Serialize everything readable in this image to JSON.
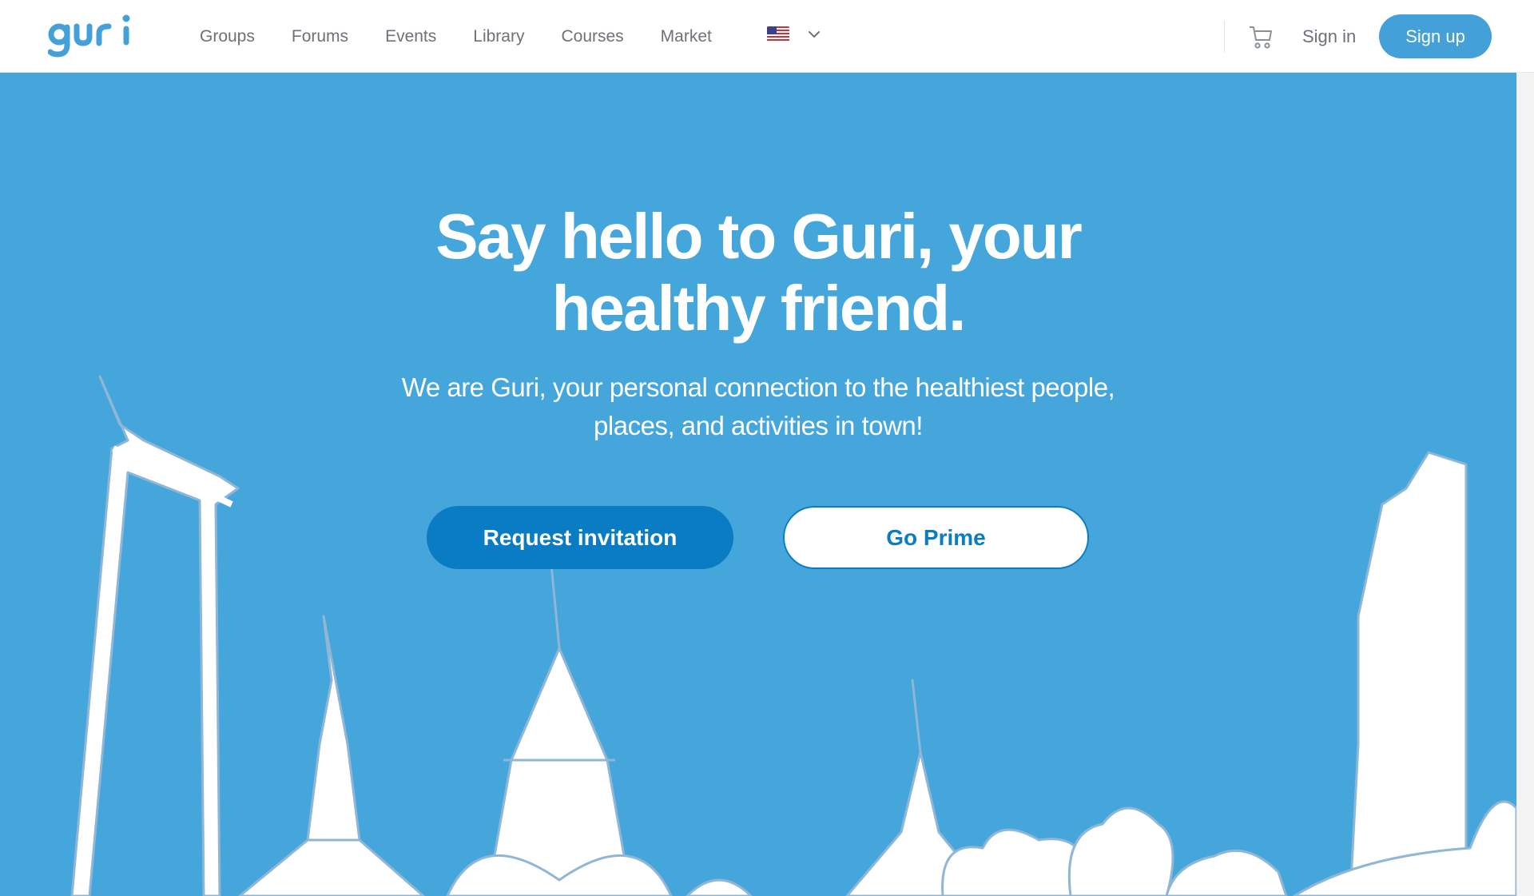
{
  "brand": {
    "name": "guri",
    "color": "#44a0d8"
  },
  "nav": {
    "items": [
      {
        "label": "Groups"
      },
      {
        "label": "Forums"
      },
      {
        "label": "Events"
      },
      {
        "label": "Library"
      },
      {
        "label": "Courses"
      },
      {
        "label": "Market"
      }
    ],
    "language": {
      "flag": "us-flag-icon",
      "dropdown": "chevron-down-icon"
    }
  },
  "header_actions": {
    "cart_icon": "cart-icon",
    "sign_in": "Sign in",
    "sign_up": "Sign up"
  },
  "hero": {
    "title_line1": "Say hello to Guri, your",
    "title_line2": "healthy friend.",
    "subtitle_line1": "We are Guri, your personal connection to the healthiest people,",
    "subtitle_line2": "places, and activities in town!",
    "primary_button": "Request invitation",
    "secondary_button": "Go Prime",
    "background_color": "#45a6db",
    "primary_color": "#0a7cc4",
    "illustration": "bangkok-skyline-illustration"
  }
}
